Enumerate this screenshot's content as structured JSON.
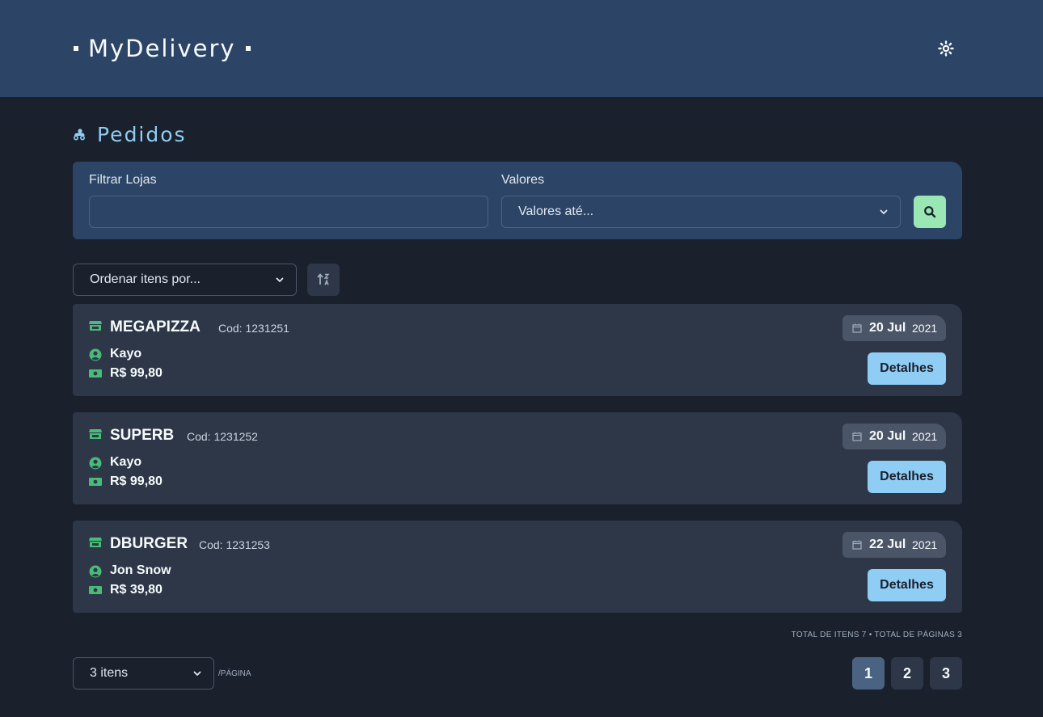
{
  "header": {
    "brand": "MyDelivery",
    "theme_icon": "sun-icon"
  },
  "page": {
    "title": "Pedidos",
    "title_icon": "delivery-icon"
  },
  "filters": {
    "store_label": "Filtrar Lojas",
    "store_value": "",
    "values_label": "Valores",
    "values_selected": "Valores até...",
    "search_icon": "search-icon"
  },
  "sorting": {
    "order_selected": "Ordenar itens por...",
    "sort_icon": "sort-alpha-icon"
  },
  "orders": [
    {
      "store": "MEGAPIZZA",
      "code": "Cod: 1231251",
      "customer": "Kayo",
      "price": "R$ 99,80",
      "day": "20 Jul",
      "year": "2021",
      "button": "Detalhes"
    },
    {
      "store": "SUPERB",
      "code": "Cod: 1231252",
      "customer": "Kayo",
      "price": "R$ 99,80",
      "day": "20 Jul",
      "year": "2021",
      "button": "Detalhes"
    },
    {
      "store": "DBURGER",
      "code": "Cod: 1231253",
      "customer": "Jon Snow",
      "price": "R$ 39,80",
      "day": "22 Jul",
      "year": "2021",
      "button": "Detalhes"
    }
  ],
  "pagination": {
    "totals": "TOTAL DE ITENS 7 • TOTAL DE PÁGINAS 3",
    "per_page_selected": "3 itens",
    "per_page_suffix": "/PÁGINA",
    "pages": [
      "1",
      "2",
      "3"
    ],
    "current_page": "1"
  },
  "colors": {
    "accent_green": "#48bb78",
    "accent_blue": "#90cdf4",
    "header_bg": "#2c4566"
  }
}
